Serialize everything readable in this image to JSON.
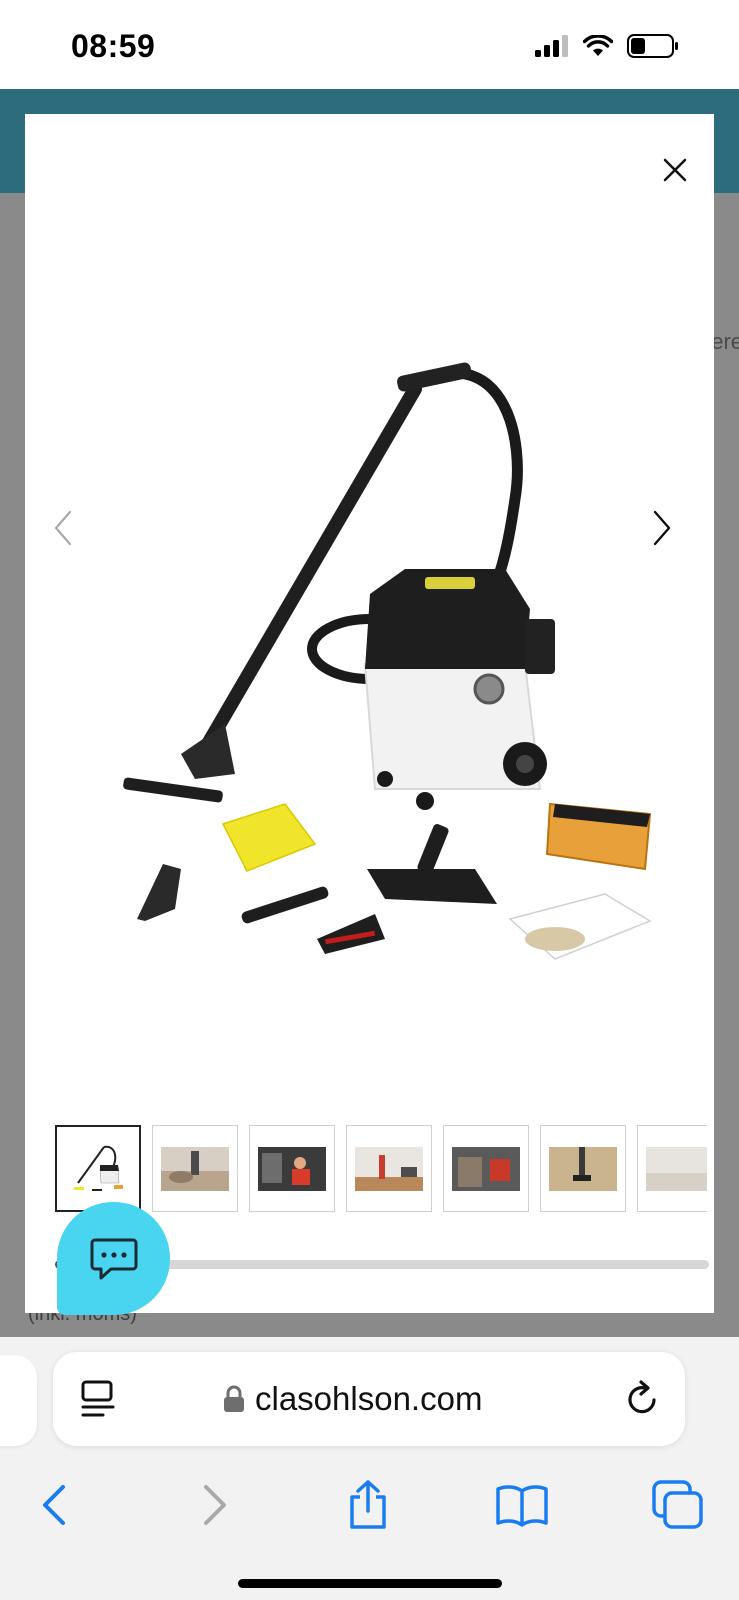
{
  "status_bar": {
    "time": "08:59",
    "signal_icon": "cellular-signal-icon",
    "wifi_icon": "wifi-icon",
    "battery_icon": "battery-icon"
  },
  "background_page": {
    "header_color": "#2c6c7c",
    "side_text": "ere",
    "bottom_text": "(inkl. moms)"
  },
  "gallery": {
    "close_icon": "close-icon",
    "prev_icon": "chevron-left-icon",
    "next_icon": "chevron-right-icon",
    "main_image": "wet-dry-vacuum-with-accessories",
    "thumbnails": [
      {
        "icon": "vacuum-product-thumbnail",
        "active": true
      },
      {
        "icon": "sofa-cleaning-photo-thumbnail",
        "active": false
      },
      {
        "icon": "car-seat-cleaning-photo-thumbnail",
        "active": false
      },
      {
        "icon": "room-vacuuming-photo-thumbnail",
        "active": false
      },
      {
        "icon": "car-interior-photo-thumbnail",
        "active": false
      },
      {
        "icon": "floor-cleaning-photo-thumbnail",
        "active": false
      },
      {
        "icon": "carpet-photo-thumbnail",
        "active": false
      }
    ],
    "scroll_progress": 0.14
  },
  "chat": {
    "icon": "chat-bubble-icon",
    "color": "#49d4f0"
  },
  "browser": {
    "url": "clasohlson.com",
    "reader_icon": "reader-mode-icon",
    "lock_icon": "lock-icon",
    "reload_icon": "reload-icon",
    "accent": "#1a7cf0",
    "toolbar": [
      {
        "icon": "back-icon",
        "enabled": true
      },
      {
        "icon": "forward-icon",
        "enabled": false
      },
      {
        "icon": "share-icon",
        "enabled": true
      },
      {
        "icon": "bookmarks-icon",
        "enabled": true
      },
      {
        "icon": "tabs-icon",
        "enabled": true
      }
    ]
  }
}
